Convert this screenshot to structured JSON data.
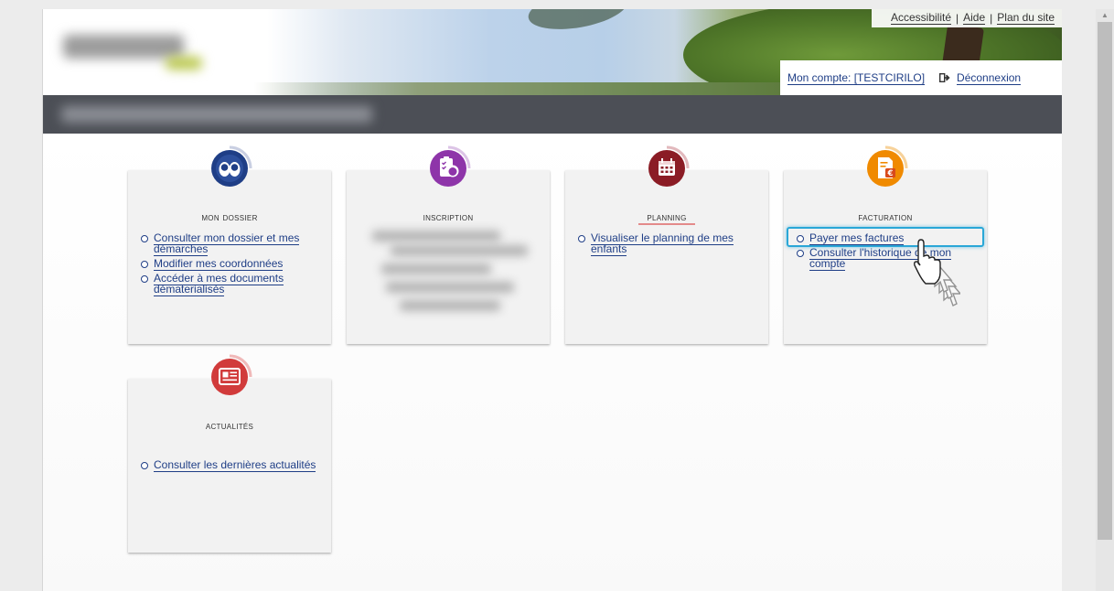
{
  "top_links": {
    "accessibility": "Accessibilité",
    "help": "Aide",
    "sitemap": "Plan du site",
    "separator": "|"
  },
  "account": {
    "my_account": "Mon compte: [TESTCIRILO]",
    "logout": "Déconnexion"
  },
  "cards": {
    "dossier": {
      "title": "Mon dossier",
      "links": [
        "Consulter mon dossier et mes démarches",
        "Modifier mes coordonnées",
        "Accéder à mes documents dématerialisés"
      ],
      "icon": "people-icon",
      "color": "#1f3e86"
    },
    "inscription": {
      "title": "Inscription",
      "icon": "clipboard-child-icon",
      "color": "#8e35a9"
    },
    "planning": {
      "title": "Planning",
      "links": [
        "Visualiser le planning de mes enfants"
      ],
      "icon": "calendar-icon",
      "color": "#8b1c25"
    },
    "facturation": {
      "title": "Facturation",
      "links": [
        "Payer mes factures",
        "Consulter l'historique de mon compte"
      ],
      "icon": "invoice-euro-icon",
      "color": "#f08a00"
    },
    "actualites": {
      "title": "Actualités",
      "links": [
        "Consulter les dernières actualités"
      ],
      "icon": "newspaper-icon",
      "color": "#d13b3b"
    }
  },
  "colors": {
    "link": "#1f3e86",
    "navbar": "#4c4f56",
    "focus": "#2aa7d7"
  }
}
